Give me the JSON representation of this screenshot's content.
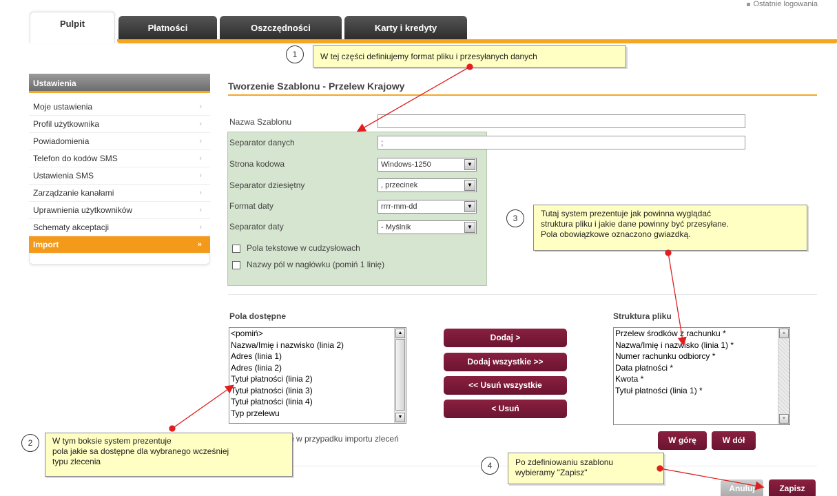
{
  "top_link": {
    "label": "Ostatnie logowania"
  },
  "tabs": [
    {
      "label": "Pulpit",
      "active": true
    },
    {
      "label": "Płatności",
      "active": false
    },
    {
      "label": "Oszczędności",
      "active": false
    },
    {
      "label": "Karty i kredyty",
      "active": false
    }
  ],
  "sidebar": {
    "title": "Ustawienia",
    "items": [
      {
        "label": "Moje ustawienia",
        "chev": "›"
      },
      {
        "label": "Profil użytkownika",
        "chev": "›"
      },
      {
        "label": "Powiadomienia",
        "chev": "›"
      },
      {
        "label": "Telefon do kodów SMS",
        "chev": "›"
      },
      {
        "label": "Ustawienia SMS",
        "chev": "›"
      },
      {
        "label": "Zarządzanie kanałami",
        "chev": "›"
      },
      {
        "label": "Uprawnienia użytkowników",
        "chev": "›"
      },
      {
        "label": "Schematy akceptacji",
        "chev": "›"
      },
      {
        "label": "Import",
        "chev": "»"
      }
    ]
  },
  "main": {
    "title": "Tworzenie Szablonu - Przelew Krajowy",
    "template_name": {
      "label": "Nazwa Szablonu",
      "value": ""
    },
    "data_separator": {
      "label": "Separator danych",
      "value": ";"
    },
    "code_page": {
      "label": "Strona kodowa",
      "value": "Windows-1250"
    },
    "decimal_separator": {
      "label": "Separator dziesiętny",
      "value": ", przecinek"
    },
    "date_format": {
      "label": "Format daty",
      "value": "rrrr-mm-dd"
    },
    "date_separator": {
      "label": "Separator daty",
      "value": "- Myślnik"
    },
    "checkbox_quotes": {
      "label": "Pola tekstowe w cudzysłowach",
      "checked": false
    },
    "checkbox_header": {
      "label": "Nazwy pól w nagłówku (pomiń 1 linię)",
      "checked": false
    },
    "available_fields": {
      "title": "Pola dostępne",
      "items": [
        "<pomiń>",
        "Nazwa/Imię i nazwisko (linia 2)",
        "Adres (linia 1)",
        "Adres (linia 2)",
        "Tytuł płatności (linia 2)",
        "Tytuł płatności (linia 3)",
        "Tytuł płatności (linia 4)",
        "Typ przelewu"
      ]
    },
    "file_structure": {
      "title": "Struktura pliku",
      "items": [
        "Przelew środków z rachunku *",
        "Nazwa/Imię i nazwisko (linia 1) *",
        "Numer rachunku odbiorcy *",
        "Data płatności *",
        "Kwota *",
        "Tytuł płatności (linia 1) *"
      ]
    },
    "buttons": {
      "add": "Dodaj >",
      "add_all": "Dodaj wszystkie >>",
      "remove_all": "<< Usuń wszystkie",
      "remove": "< Usuń",
      "up": "W górę",
      "down": "W dół",
      "cancel": "Anuluj",
      "save": "Zapisz"
    },
    "note_fragment": "e w przypadku importu zleceń"
  },
  "callouts": [
    {
      "num": "1",
      "text": "W tej części definiujemy format pliku i przesyłanych danych"
    },
    {
      "num": "2",
      "line1": "W tym boksie system prezentuje",
      "line2": "pola jakie sa dostępne dla wybranego wcześniej",
      "line3": "typu zlecenia"
    },
    {
      "num": "3",
      "line1": "Tutaj system prezentuje jak powinna wyglądać",
      "line2": "struktura pliku i jakie dane powinny być przesyłane.",
      "line3": "Pola obowiązkowe oznaczono gwiazdką."
    },
    {
      "num": "4",
      "line1": "Po zdefiniowaniu szablonu",
      "line2": "wybieramy \"Zapisz\""
    }
  ],
  "colors": {
    "accent_orange": "#f5a623",
    "button_maroon": "#7a1838",
    "callout_bg": "#ffffc4",
    "panel_green": "#d6e5cf",
    "arrow_red": "#e02020"
  }
}
